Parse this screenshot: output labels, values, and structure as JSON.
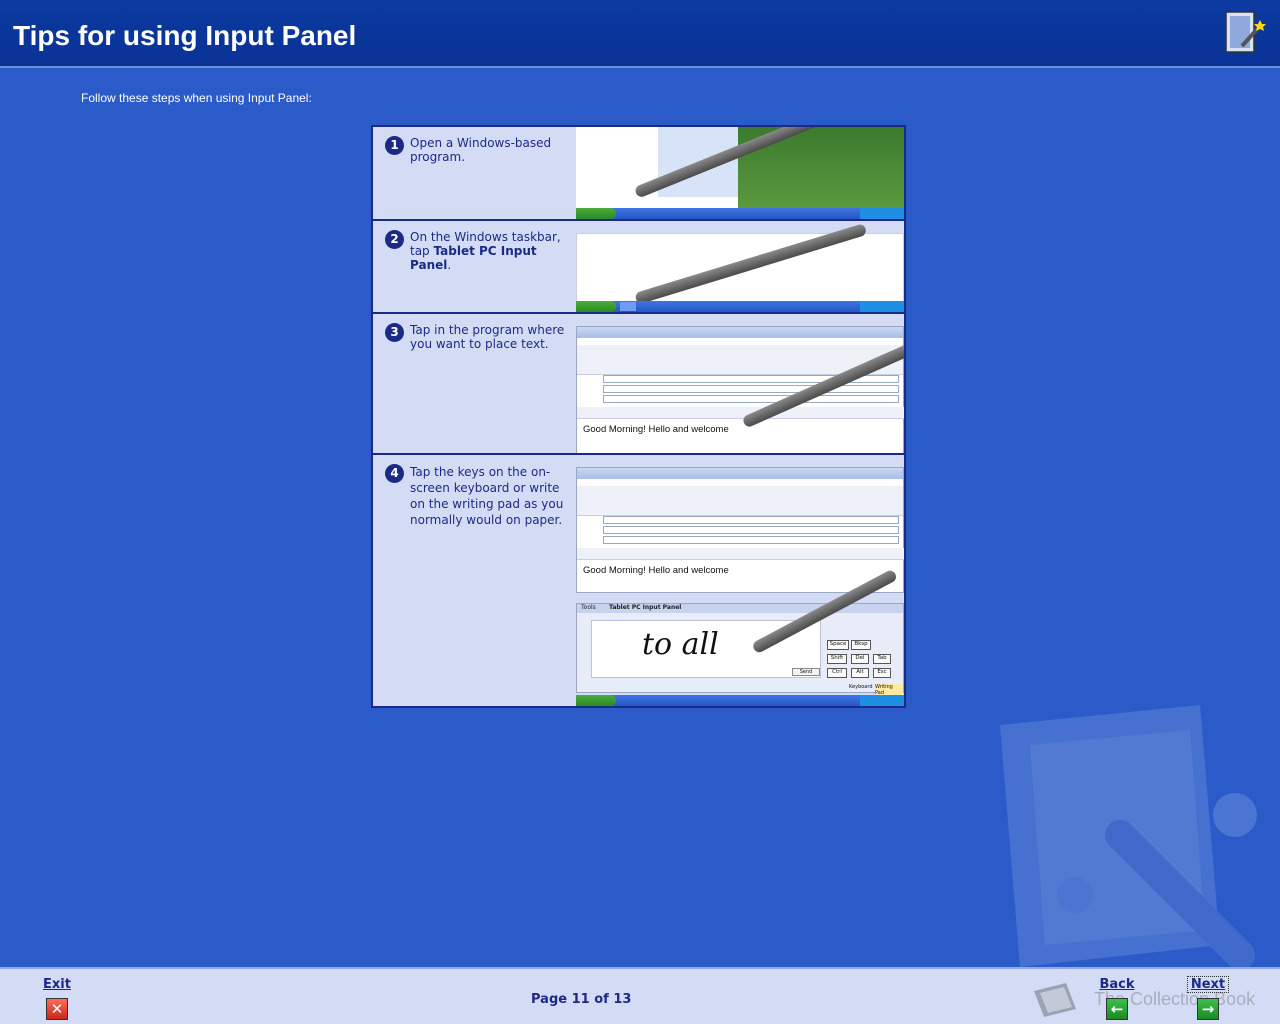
{
  "header": {
    "title": "Tips for using Input Panel",
    "icon": "wizard-icon"
  },
  "intro": "Follow these steps when using Input Panel:",
  "steps": [
    {
      "num": "1",
      "text_a": "Open a Windows-based program.",
      "text_b": "",
      "text_bold": "",
      "text_c": ""
    },
    {
      "num": "2",
      "text_a": "On the Windows taskbar, tap ",
      "text_bold": "Tablet PC Input Panel",
      "text_c": "."
    },
    {
      "num": "3",
      "text_a": "Tap in the program where you want to place text.",
      "text_bold": "",
      "text_c": ""
    },
    {
      "num": "4",
      "text_a": "Tap the keys on the on-screen keyboard or write on the writing pad as you normally would on paper.",
      "text_bold": "",
      "text_c": ""
    }
  ],
  "screens": {
    "message_text": "Good Morning! Hello and welcome",
    "input_panel_title": "Tablet PC Input Panel",
    "tools_label": "Tools",
    "handwriting": "to all",
    "keys": [
      "Space",
      "Bksp",
      "Shift",
      "Del",
      "Tab",
      "Ctrl",
      "Alt",
      "Esc"
    ],
    "send_label": "Send",
    "tab_keyboard": "Keyboard",
    "tab_writing_pad": "Writing Pad"
  },
  "footer": {
    "exit_label": "Exit",
    "back_label": "Back",
    "next_label": "Next",
    "page_indicator": "Page 11 of 13",
    "brand": "The Collection Book"
  }
}
